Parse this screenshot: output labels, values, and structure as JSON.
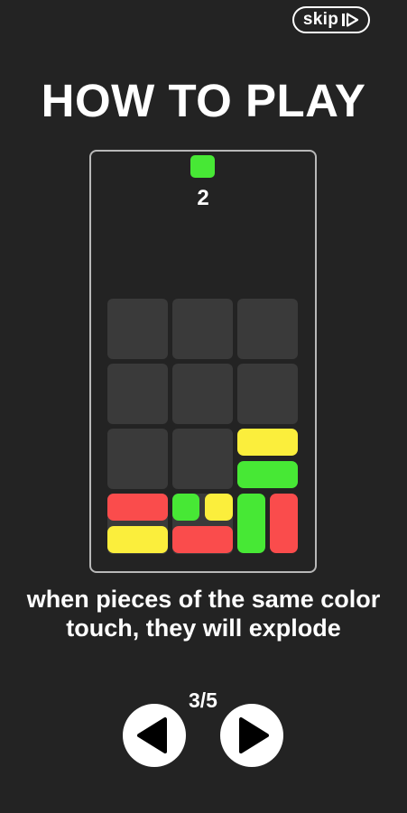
{
  "header": {
    "skip_label": "skip",
    "skip_icon": "skip-forward-icon"
  },
  "title": "HOW TO PLAY",
  "next_piece": {
    "color": "#47e835",
    "count": "2"
  },
  "board": {
    "rows": 4,
    "cols": 3,
    "empty_cell_color": "#3a3a3a",
    "pieces": [
      {
        "row": 3,
        "col": 2,
        "shape": "horizontal-top",
        "color": "#fbee3c"
      },
      {
        "row": 3,
        "col": 2,
        "shape": "horizontal-bottom",
        "color": "#47e835"
      },
      {
        "row": 4,
        "col": 1,
        "shape": "horizontal-top",
        "color": "#fa4c4c"
      },
      {
        "row": 4,
        "col": 1,
        "shape": "horizontal-bottom",
        "color": "#fbee3c"
      },
      {
        "row": 4,
        "col": 2,
        "shape": "small-top-left",
        "color": "#47e835"
      },
      {
        "row": 4,
        "col": 2,
        "shape": "small-top-right",
        "color": "#fbee3c"
      },
      {
        "row": 4,
        "col": 2,
        "shape": "horizontal-bottom",
        "color": "#fa4c4c"
      },
      {
        "row": 4,
        "col": 3,
        "shape": "vertical-left",
        "color": "#47e835"
      },
      {
        "row": 4,
        "col": 3,
        "shape": "vertical-right",
        "color": "#fa4c4c"
      }
    ]
  },
  "caption": "when pieces of the same color touch, they will explode",
  "pagination": {
    "indicator": "3/5",
    "current": 3,
    "total": 5,
    "prev_icon": "triangle-left-icon",
    "next_icon": "triangle-right-icon"
  },
  "colors": {
    "background": "#232323",
    "green": "#47e835",
    "yellow": "#fbee3c",
    "red": "#fa4c4c"
  }
}
